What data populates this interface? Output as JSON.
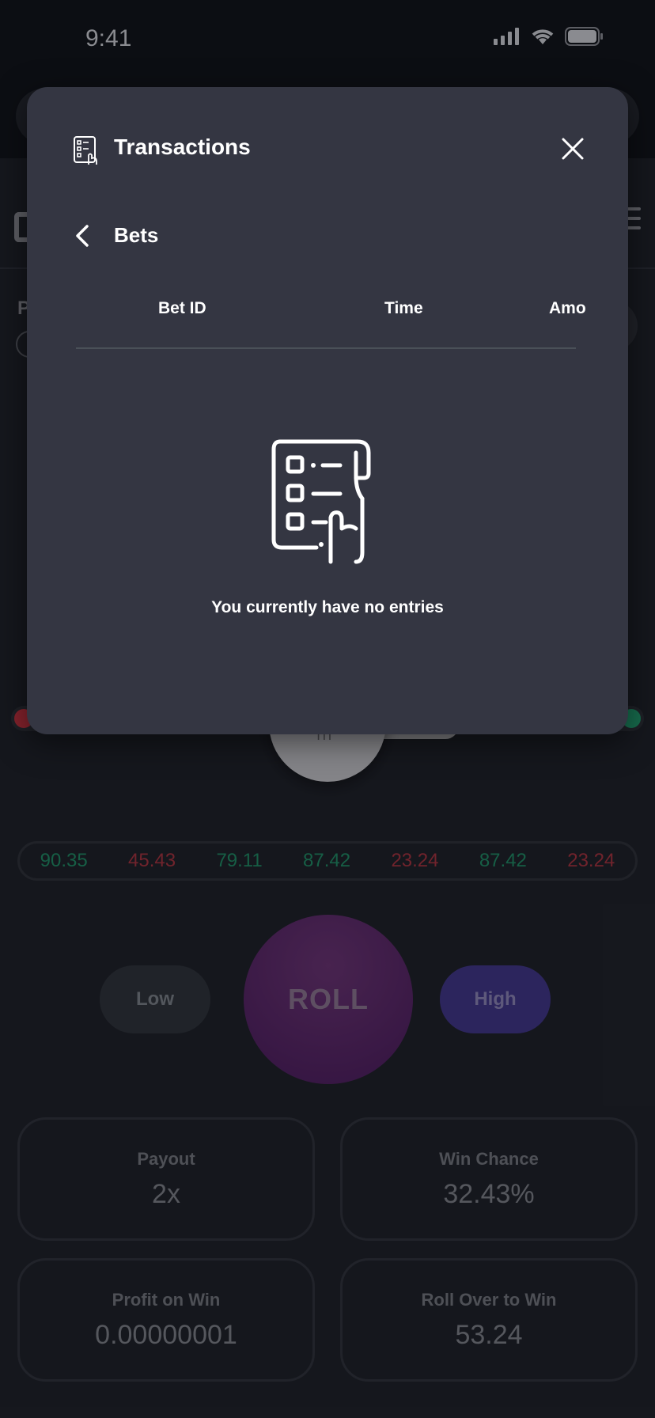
{
  "status_bar": {
    "time": "9:41"
  },
  "modal": {
    "title": "Transactions",
    "subtitle": "Bets",
    "columns": [
      "Bet ID",
      "Time",
      "Amo"
    ],
    "empty_message": "You currently have no entries"
  },
  "history": [
    "90.35",
    "45.43",
    "79.11",
    "87.42",
    "23.24",
    "87.42",
    "23.24"
  ],
  "controls": {
    "low": "Low",
    "roll": "ROLL",
    "high": "High"
  },
  "stats": {
    "payout": {
      "label": "Payout",
      "value": "2x"
    },
    "win_chance": {
      "label": "Win Chance",
      "value": "32.43%"
    },
    "profit": {
      "label": "Profit on Win",
      "value": "0.00000001"
    },
    "roll_over": {
      "label": "Roll Over to Win",
      "value": "53.24"
    }
  },
  "background": {
    "partial_label": "P"
  },
  "colors": {
    "modal_bg": "#343642",
    "up": "#1e8c63",
    "down": "#a8323c",
    "roll": "#5a2668",
    "high": "#3f3587"
  }
}
